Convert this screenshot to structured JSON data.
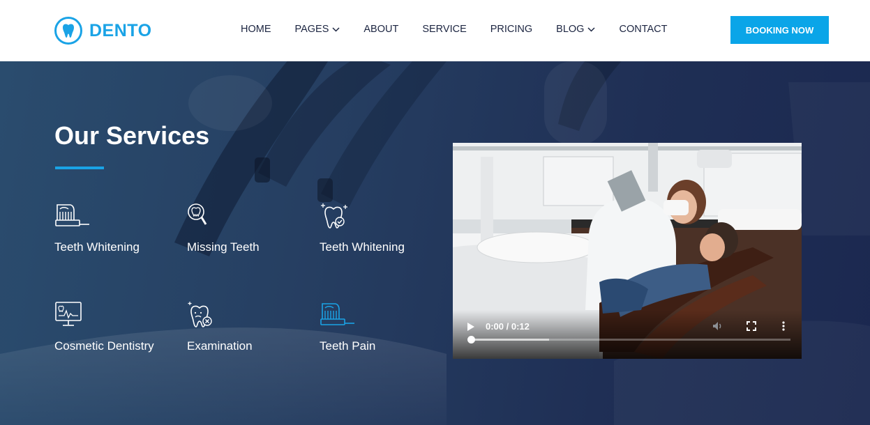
{
  "brand": {
    "name": "DENTO",
    "icon": "tooth-icon",
    "color": "#1aa3e6"
  },
  "nav": {
    "items": [
      {
        "label": "HOME",
        "dropdown": false
      },
      {
        "label": "PAGES",
        "dropdown": true
      },
      {
        "label": "ABOUT",
        "dropdown": false
      },
      {
        "label": "SERVICE",
        "dropdown": false
      },
      {
        "label": "PRICING",
        "dropdown": false
      },
      {
        "label": "BLOG",
        "dropdown": true
      },
      {
        "label": "CONTACT",
        "dropdown": false
      }
    ],
    "cta_label": "BOOKING NOW",
    "cta_color": "#0aa5e8"
  },
  "hero": {
    "title": "Our Services",
    "services": [
      {
        "label": "Teeth Whitening",
        "icon": "toothbrush-icon"
      },
      {
        "label": "Missing Teeth",
        "icon": "tooth-magnifier-icon"
      },
      {
        "label": "Teeth Whitening",
        "icon": "sparkling-tooth-icon"
      },
      {
        "label": "Cosmetic Dentistry",
        "icon": "xray-monitor-icon"
      },
      {
        "label": "Examination",
        "icon": "tooth-x-icon"
      },
      {
        "label": "Teeth Pain",
        "icon": "toothbrush-icon"
      }
    ]
  },
  "video": {
    "time_display": "0:00 / 0:12",
    "progress": 0.0,
    "buffered": 0.25
  }
}
